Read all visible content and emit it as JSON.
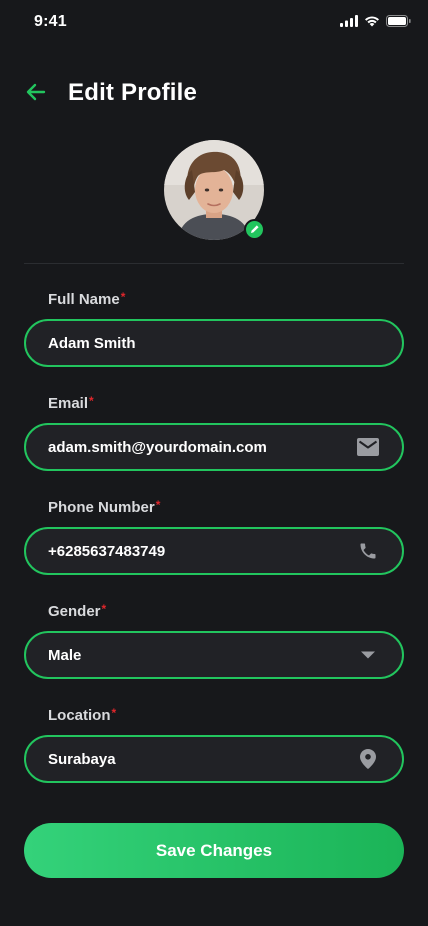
{
  "status_bar": {
    "time": "9:41"
  },
  "header": {
    "title": "Edit Profile"
  },
  "form": {
    "required_mark": "*",
    "full_name": {
      "label": "Full Name",
      "value": "Adam Smith"
    },
    "email": {
      "label": "Email",
      "value": "adam.smith@yourdomain.com",
      "icon": "mail-icon"
    },
    "phone": {
      "label": "Phone Number",
      "value": "+6285637483749",
      "icon": "phone-icon"
    },
    "gender": {
      "label": "Gender",
      "value": "Male",
      "icon": "caret-down-icon"
    },
    "location": {
      "label": "Location",
      "value": "Surabaya",
      "icon": "location-pin-icon"
    }
  },
  "actions": {
    "save_label": "Save Changes"
  },
  "colors": {
    "background": "#17181b",
    "accent": "#22c55e",
    "field_bg": "#212226",
    "required": "#e0262b",
    "icon": "#9a9ca1"
  }
}
